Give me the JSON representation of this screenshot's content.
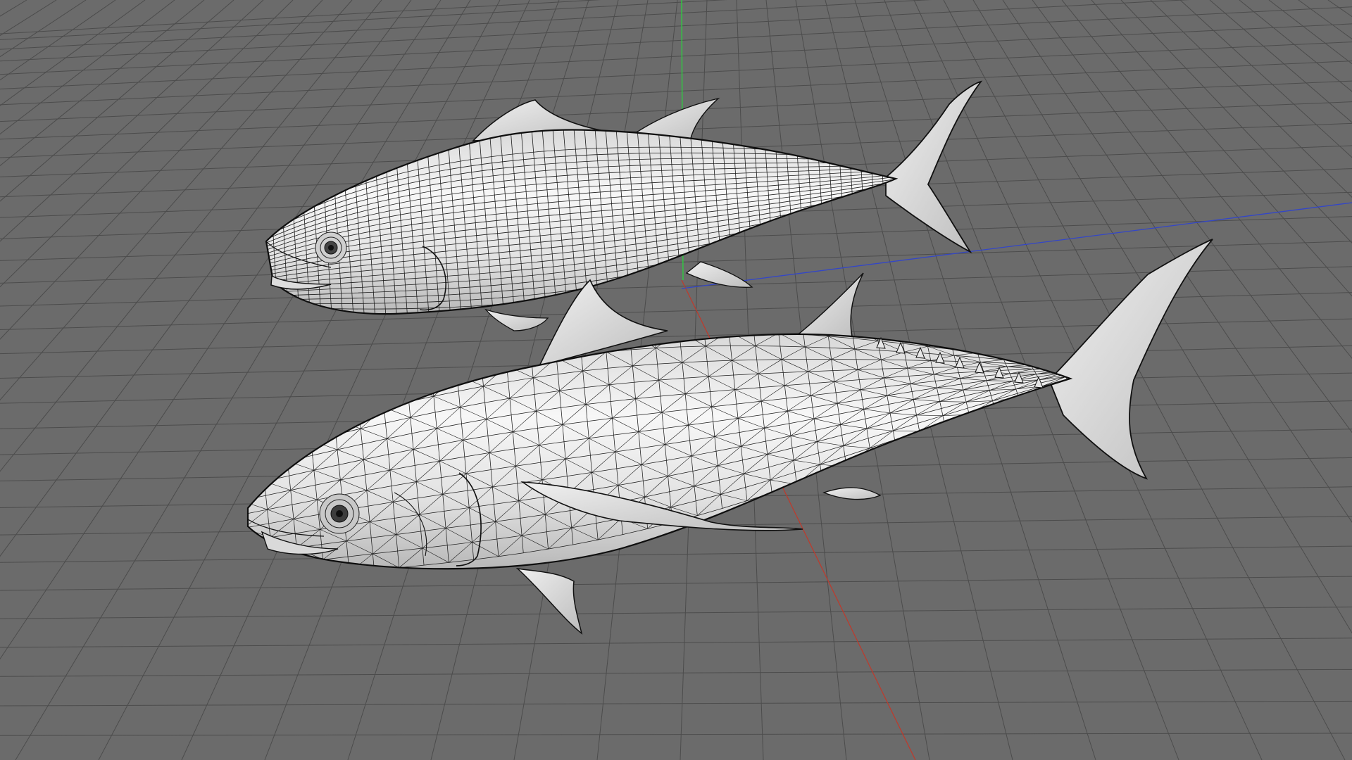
{
  "viewport": {
    "background": "#6b6b6b",
    "grid_color": "#4c4c4c",
    "grid_enabled": true,
    "axes": {
      "x_color": "#c0392b",
      "y_color": "#2ecc40",
      "z_color": "#3346c8"
    }
  },
  "objects": [
    {
      "name": "tuna-model-upper",
      "display": "wireframe-on-shaded",
      "wire_color": "#141414",
      "surface_color": "#e6e6e6"
    },
    {
      "name": "tuna-model-lower",
      "display": "wireframe-on-shaded",
      "wire_color": "#141414",
      "surface_color": "#e6e6e6"
    }
  ]
}
